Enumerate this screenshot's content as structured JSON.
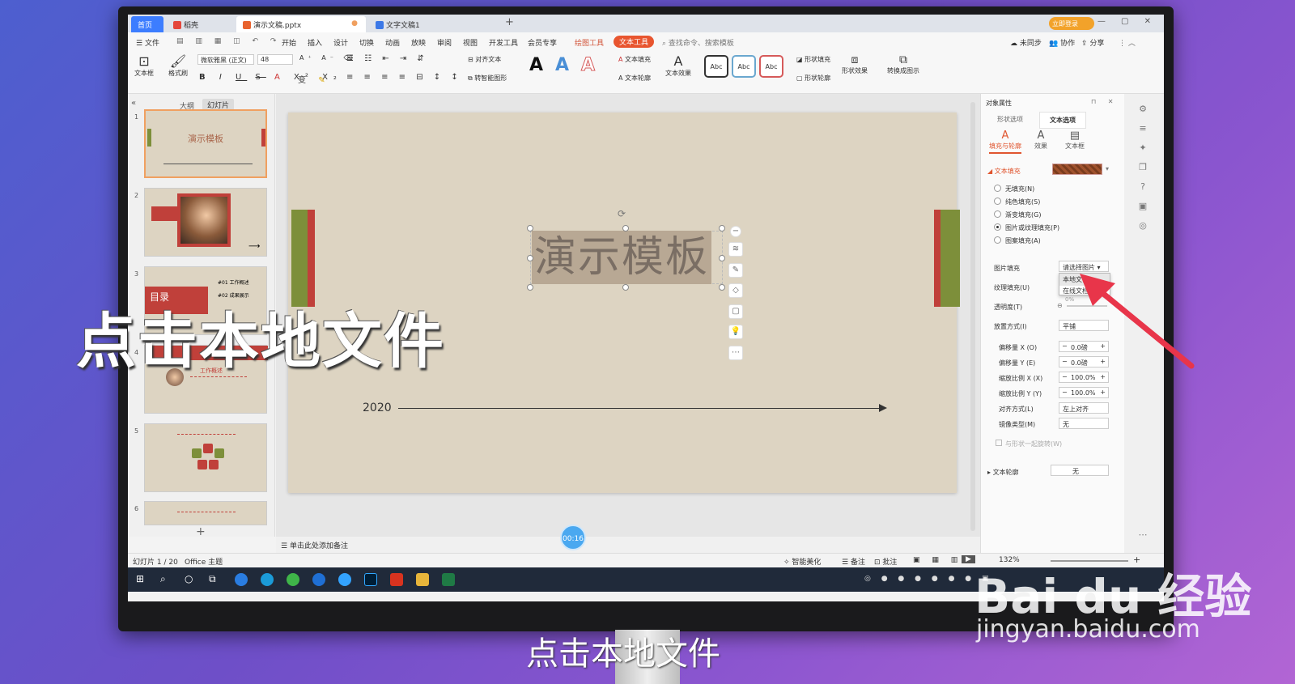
{
  "tabs": [
    {
      "label": "首页"
    },
    {
      "label": "稻壳"
    },
    {
      "label": "演示文稿.pptx"
    },
    {
      "label": "文字文稿1"
    }
  ],
  "window": {
    "login": "立即登录",
    "new_tab": "+"
  },
  "menu": [
    "文件",
    "开始",
    "插入",
    "设计",
    "切换",
    "动画",
    "放映",
    "审阅",
    "视图",
    "开发工具",
    "会员专享",
    "绘图工具",
    "文本工具"
  ],
  "search_placeholder": "查找命令、搜索模板",
  "top_right": [
    "未同步",
    "协作",
    "分享"
  ],
  "ribbon": {
    "textbox": "文本框",
    "format_painter": "格式刷",
    "font_name": "微软雅黑 (正文)",
    "font_size": "48",
    "align_text": "对齐文本",
    "smartart": "转智能图形",
    "text_fill": "文本填充",
    "text_outline": "文本轮廓",
    "text_effect": "文本效果",
    "shape_fill": "形状填充",
    "shape_outline": "形状轮廓",
    "shape_effect": "形状效果",
    "convert": "转换成图示",
    "style_A_colors": [
      "#111111",
      "#4a8fd6",
      "#d65a5a"
    ],
    "abc": [
      "Abc",
      "Abc",
      "Abc"
    ]
  },
  "left_panel": {
    "tab_outline": "大纲",
    "tab_slides": "幻灯片",
    "slide_numbers": [
      "1",
      "2",
      "3",
      "4",
      "5",
      "6"
    ],
    "slide1_title": "演示模板",
    "slide3_items": [
      "#01 工作概述",
      "#02 成果展示"
    ],
    "slide3_title": "目录",
    "slide4_title": "工作概述",
    "add": "+"
  },
  "slide": {
    "title": "演示模板",
    "year": "2020",
    "colors": {
      "green": "#7d8f3a",
      "red": "#c0403a",
      "bg": "#ddd4c2"
    }
  },
  "notes_placeholder": "单击此处添加备注",
  "timer": "00:16",
  "right_panel": {
    "header": "对象属性",
    "tab_shape": "形状选项",
    "tab_text": "文本选项",
    "sub_fill": "填充与轮廓",
    "sub_effect": "效果",
    "sub_textbox": "文本框",
    "section_fill": "文本填充",
    "fill_options": [
      {
        "label": "无填充(N)",
        "checked": false
      },
      {
        "label": "纯色填充(S)",
        "checked": false
      },
      {
        "label": "渐变填充(G)",
        "checked": false
      },
      {
        "label": "图片或纹理填充(P)",
        "checked": true
      },
      {
        "label": "图案填充(A)",
        "checked": false
      }
    ],
    "picture_fill_label": "图片填充",
    "picture_fill_value": "请选择图片",
    "dropdown_items": [
      "本地文件",
      "在线文档"
    ],
    "texture_fill_label": "纹理填充(U)",
    "transparency_label": "透明度(T)",
    "transparency_value": "0%",
    "placement_label": "放置方式(I)",
    "placement_value": "平铺",
    "offset_x_label": "偏移量 X (O)",
    "offset_x": "0.0磅",
    "offset_y_label": "偏移量 Y (E)",
    "offset_y": "0.0磅",
    "scale_x_label": "缩放比例 X (X)",
    "scale_x": "100.0%",
    "scale_y_label": "缩放比例 Y (Y)",
    "scale_y": "100.0%",
    "align_label": "对齐方式(L)",
    "align_value": "左上对齐",
    "mirror_label": "镜像类型(M)",
    "mirror_value": "无",
    "rotate_with_shape": "与形状一起旋转(W)",
    "outline_label": "文本轮廓",
    "outline_value": "无"
  },
  "status": {
    "slide_info": "幻灯片 1 / 20",
    "theme": "Office 主题",
    "beautify": "智能美化",
    "notes": "备注",
    "comment": "批注",
    "zoom": "132%"
  },
  "overlay": {
    "caption_big": "点击本地文件",
    "caption_bottom": "点击本地文件",
    "watermark_brand": "Bai du 经验",
    "watermark_url": "jingyan.baidu.com",
    "arrow_color": "#e8354a"
  }
}
